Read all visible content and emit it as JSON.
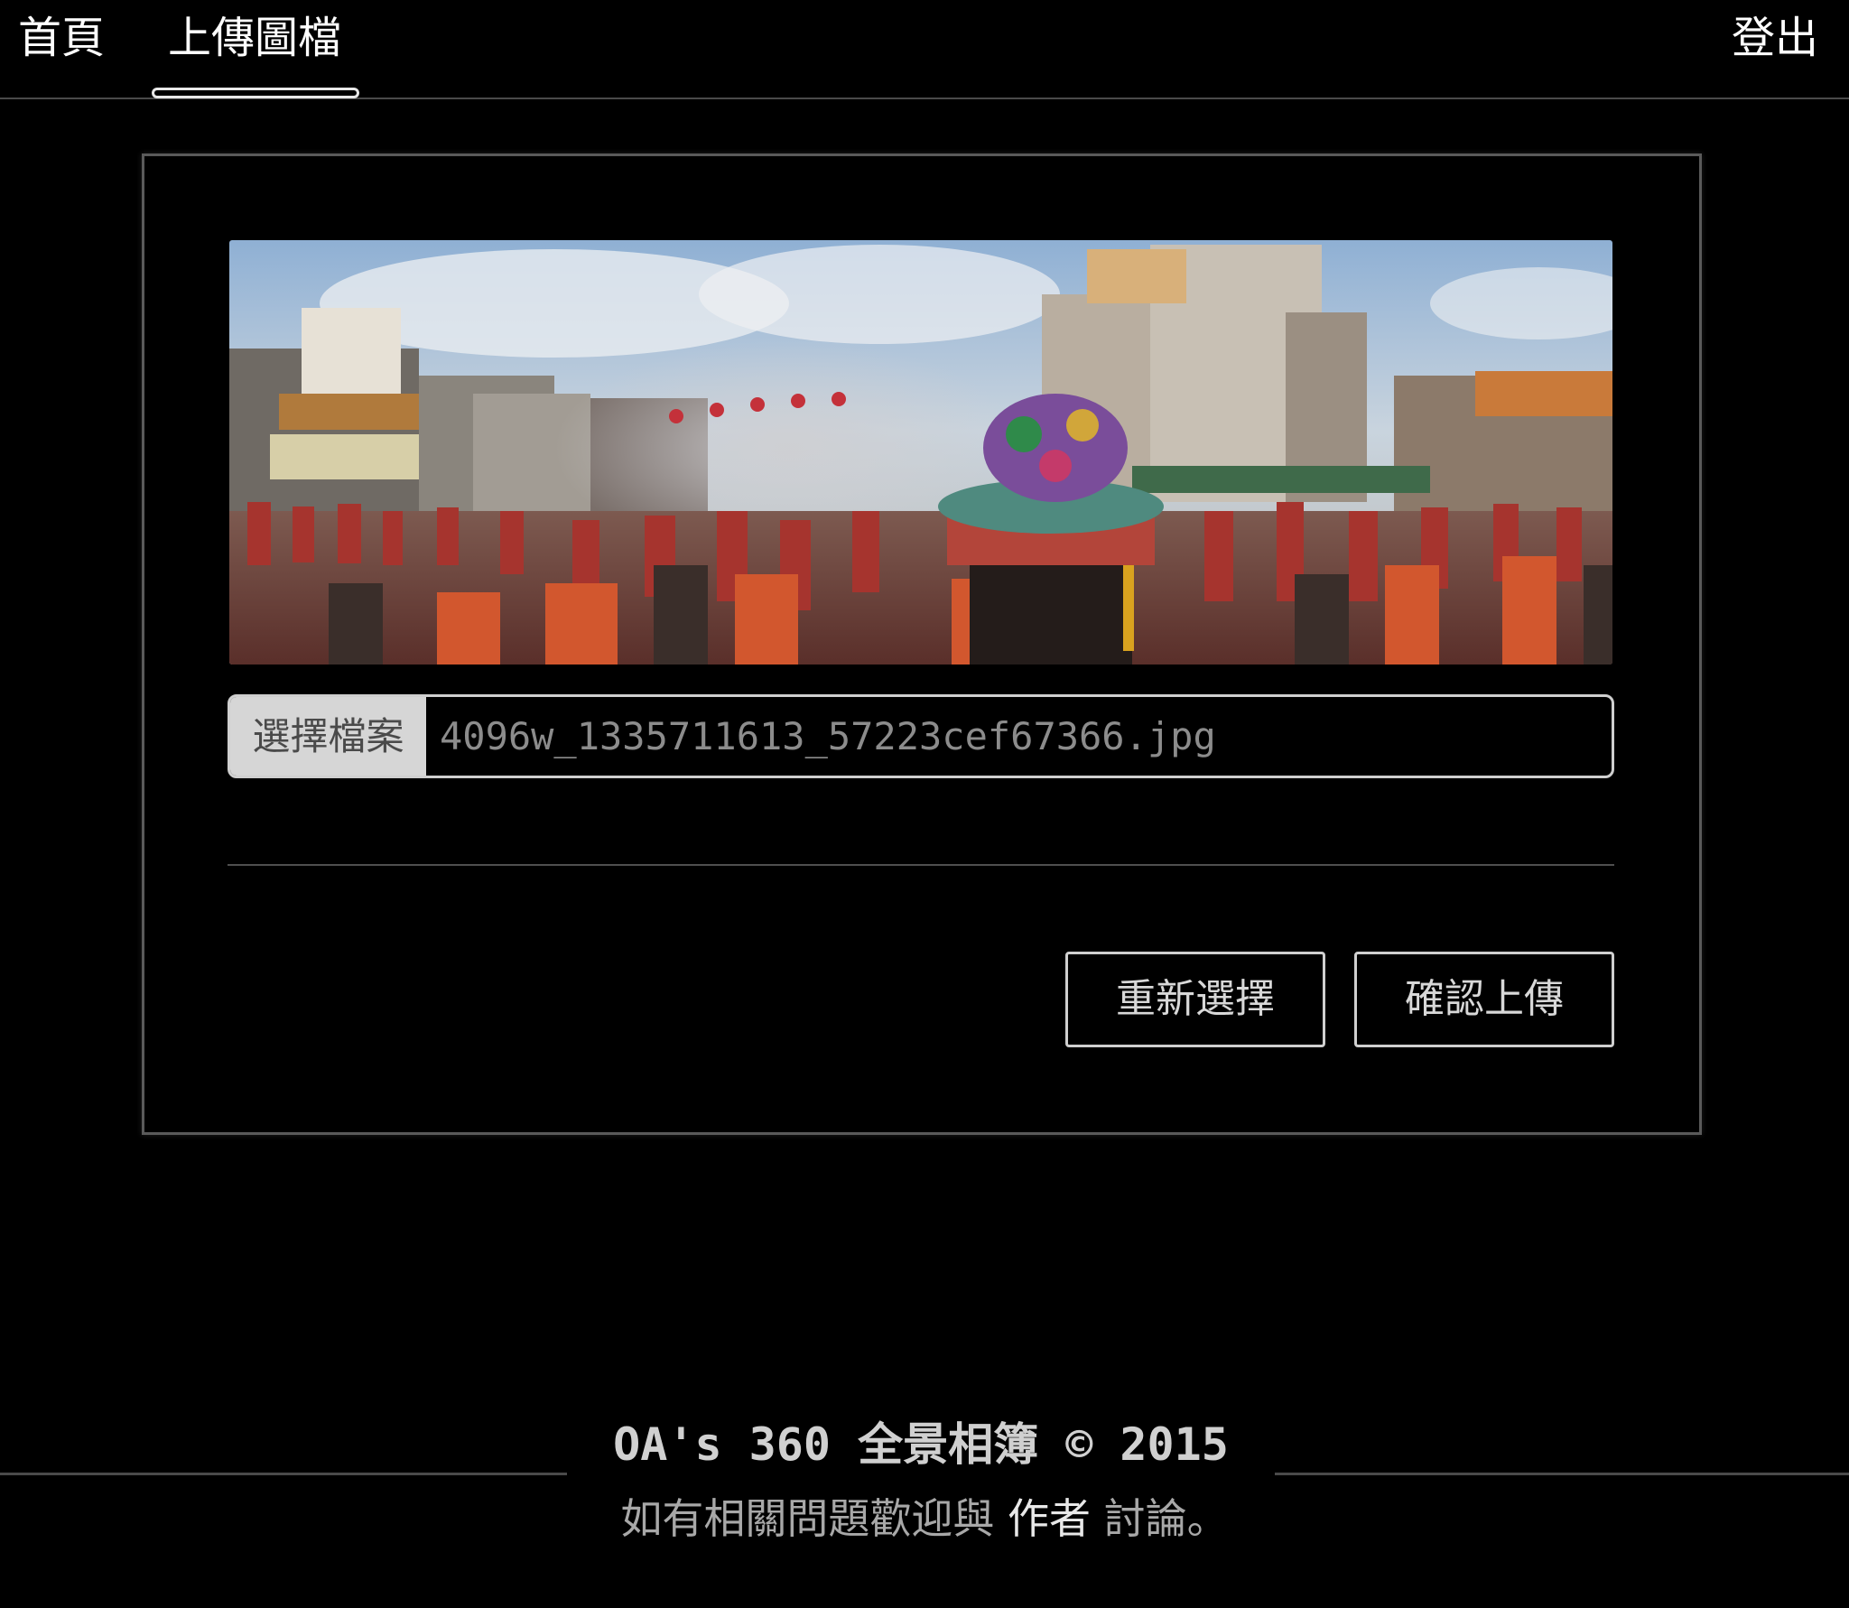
{
  "nav": {
    "home_label": "首頁",
    "upload_label": "上傳圖檔",
    "logout_label": "登出"
  },
  "upload": {
    "choose_file_label": "選擇檔案",
    "file_name": "4096w_1335711613_57223cef67366.jpg",
    "reselect_label": "重新選擇",
    "confirm_label": "確認上傳"
  },
  "footer": {
    "title": "OA's 360 全景相簿 © 2015",
    "note_before": "如有相關問題歡迎與 ",
    "author_link": "作者",
    "note_after": " 討論。"
  }
}
